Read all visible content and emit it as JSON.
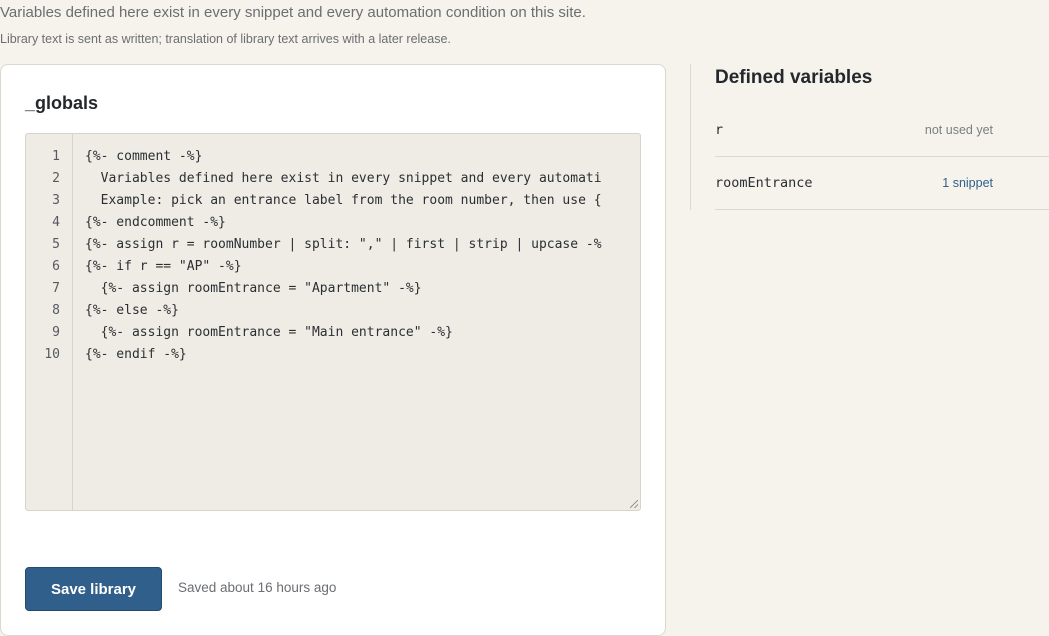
{
  "intro": {
    "main": "Variables defined here exist in every snippet and every automation condition on this site.",
    "sub": "Library text is sent as written; translation of library text arrives with a later release."
  },
  "editor_card": {
    "title": "_globals",
    "lines": [
      {
        "n": "1",
        "text": "{%- comment -%}"
      },
      {
        "n": "2",
        "text": "  Variables defined here exist in every snippet and every automati"
      },
      {
        "n": "3",
        "text": "  Example: pick an entrance label from the room number, then use {"
      },
      {
        "n": "4",
        "text": "{%- endcomment -%}"
      },
      {
        "n": "5",
        "text": "{%- assign r = roomNumber | split: \",\" | first | strip | upcase -%"
      },
      {
        "n": "6",
        "text": "{%- if r == \"AP\" -%}"
      },
      {
        "n": "7",
        "text": "  {%- assign roomEntrance = \"Apartment\" -%}"
      },
      {
        "n": "8",
        "text": "{%- else -%}"
      },
      {
        "n": "9",
        "text": "  {%- assign roomEntrance = \"Main entrance\" -%}"
      },
      {
        "n": "10",
        "text": "{%- endif -%}"
      }
    ],
    "save_label": "Save library",
    "saved_status": "Saved about 16 hours ago"
  },
  "sidebar": {
    "title": "Defined variables",
    "variables": [
      {
        "name": "r",
        "usage": "not used yet"
      },
      {
        "name": "roomEntrance",
        "usage": "1 snippet"
      }
    ]
  },
  "colors": {
    "page_bg": "#f6f3ed",
    "editor_bg": "#efece6",
    "accent": "#2f5f8a",
    "muted_text": "#6b6e72"
  }
}
